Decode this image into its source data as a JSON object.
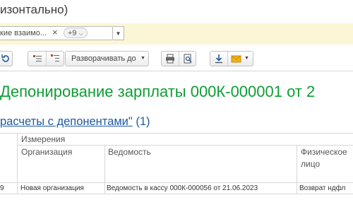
{
  "window": {
    "title": "изонтально)"
  },
  "filter": {
    "text": "кие взаимо...",
    "more_label": "+9",
    "chevron": "chevron-down-icon"
  },
  "toolbar": {
    "expand_label": "Разворачивать до",
    "icons": [
      "refresh-icon",
      "collapse-rows-icon",
      "expand-rows-icon",
      "print-icon",
      "preview-icon",
      "download-icon",
      "mail-icon"
    ]
  },
  "report": {
    "title": "Депонирование зарплаты 000К-000001 от 2",
    "section_link": "расчеты с депонентами\"",
    "section_count": " (1)"
  },
  "table": {
    "group_header": "Измерения",
    "columns": [
      "Организация",
      "Ведомость",
      "Физическое",
      "лицо"
    ],
    "row": {
      "num": "9",
      "organization": "Новая организация",
      "statement": "Ведомость в кассу 000К-000056 от 21.06.2023",
      "person": "Возврат ндфл"
    }
  },
  "colors": {
    "accent_green": "#0f9d35",
    "link_blue": "#1e5aa0",
    "filter_bg": "#fbf6d6"
  }
}
